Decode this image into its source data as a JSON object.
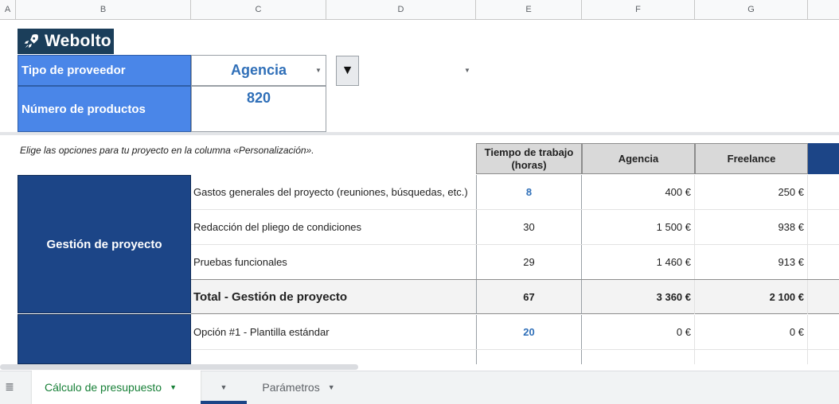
{
  "columns": [
    "A",
    "B",
    "C",
    "D",
    "E",
    "F",
    "G"
  ],
  "logo": {
    "text": "Webolto",
    "icon": "rocket-icon"
  },
  "settings": {
    "provider_label": "Tipo de proveedor",
    "provider_value": "Agencia",
    "products_label": "Número de productos",
    "products_value": "820",
    "dropdown_glyph": "▼"
  },
  "note": "Elige las opciones para tu proyecto en la columna «Personalización».",
  "table": {
    "headers": {
      "hours": "Tiempo de trabajo (horas)",
      "agency": "Agencia",
      "freelance": "Freelance"
    },
    "sections": [
      {
        "label": "Gestión de proyecto",
        "rows": [
          {
            "desc": "Gastos generales del proyecto (reuniones, búsquedas, etc.)",
            "hours": "8",
            "agency": "400 €",
            "freelance": "250 €"
          },
          {
            "desc": "Redacción del pliego de condiciones",
            "hours": "30",
            "agency": "1 500 €",
            "freelance": "938 €"
          },
          {
            "desc": "Pruebas funcionales",
            "hours": "29",
            "agency": "1 460 €",
            "freelance": "913 €"
          }
        ],
        "total": {
          "desc": "Total - Gestión de proyecto",
          "hours": "67",
          "agency": "3 360 €",
          "freelance": "2 100 €"
        }
      },
      {
        "label": "",
        "rows": [
          {
            "desc": "Opción #1 - Plantilla estándar",
            "hours": "20",
            "agency": "0 €",
            "freelance": "0 €"
          }
        ]
      }
    ]
  },
  "sheet_tabs": {
    "active": "Cálculo de presupuesto",
    "other": "Parámetros"
  },
  "colors": {
    "brand": "#1b3e5a",
    "label_blue": "#4a86e8",
    "section_navy": "#1c4587",
    "value_blue": "#2f6fb8",
    "tab_green": "#188038"
  }
}
